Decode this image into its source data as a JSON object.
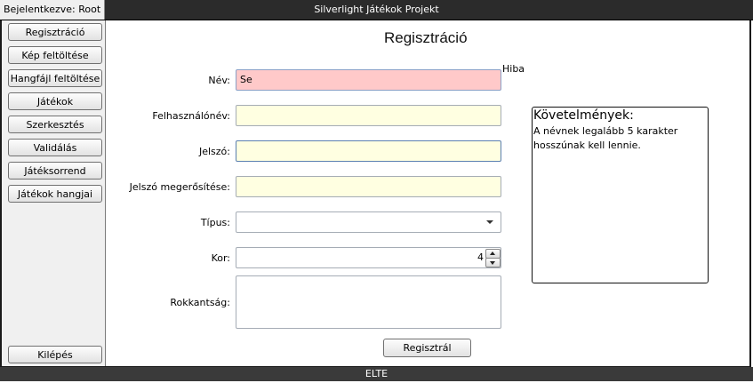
{
  "window": {
    "login_status": "Bejelentkezve: Root",
    "title": "Silverlight Játékok Projekt",
    "footer": "ELTE"
  },
  "sidebar": {
    "items": [
      {
        "label": "Regisztráció"
      },
      {
        "label": "Kép feltöltése"
      },
      {
        "label": "Hangfájl feltöltése"
      },
      {
        "label": "Játékok"
      },
      {
        "label": "Szerkesztés"
      },
      {
        "label": "Validálás"
      },
      {
        "label": "Játéksorrend"
      },
      {
        "label": "Játékok hangjai"
      }
    ],
    "logout": "Kilépés"
  },
  "form": {
    "title": "Regisztráció",
    "error_label": "Hiba",
    "name": {
      "label": "Név:",
      "value": "Se"
    },
    "username": {
      "label": "Felhasználónév:",
      "value": ""
    },
    "password": {
      "label": "Jelszó:",
      "value": ""
    },
    "password_confirm": {
      "label": "Jelszó megerősítése:",
      "value": ""
    },
    "type": {
      "label": "Típus:",
      "value": ""
    },
    "age": {
      "label": "Kor:",
      "value": "4"
    },
    "disability": {
      "label": "Rokkantság:",
      "value": ""
    },
    "submit": "Regisztrál"
  },
  "requirements": {
    "title": "Követelmények:",
    "text": "A névnek legalább 5 karakter hosszúnak kell lennie."
  },
  "colors": {
    "error_field": "#ffc9c9",
    "input_field": "#ffffe1",
    "title_bar": "#2b2b2b"
  }
}
